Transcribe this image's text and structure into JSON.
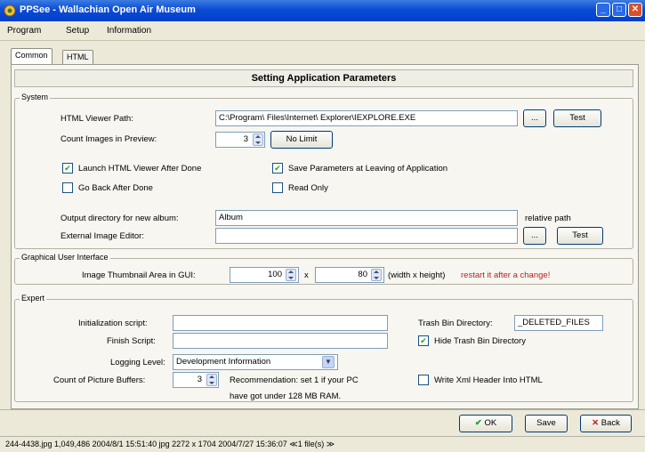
{
  "window": {
    "title": "PPSee - Wallachian Open Air Museum",
    "controls": [
      "_",
      "□",
      "✕"
    ]
  },
  "menu": [
    "Program",
    "Setup",
    "Information"
  ],
  "tabs": [
    "Common",
    "HTML"
  ],
  "header": "Setting Application Parameters",
  "system": {
    "legend": "System",
    "viewer_path_label": "HTML Viewer Path:",
    "viewer_path_value": "C:\\Program\\ Files\\Internet\\ Explorer\\IEXPLORE.EXE",
    "browse_label": "...",
    "test_label": "Test",
    "count_images_label": "Count Images in Preview:",
    "count_images_value": "3",
    "no_limit_label": "No Limit",
    "launch_viewer_label": "Launch HTML Viewer After Done",
    "save_params_label": "Save Parameters at Leaving of Application",
    "go_back_label": "Go Back After Done",
    "read_only_label": "Read Only",
    "output_dir_label": "Output directory for new album:",
    "output_dir_value": "Album",
    "relative_path_label": "relative path",
    "ext_editor_label": "External Image Editor:",
    "ext_editor_value": "",
    "browse2_label": "...",
    "test2_label": "Test"
  },
  "gui": {
    "legend": "Graphical User Interface",
    "thumb_label": "Image Thumbnail Area in GUI:",
    "width_value": "100",
    "times_label": "x",
    "height_value": "80",
    "wh_label": "(width x height)",
    "restart_note": "restart it after a change!"
  },
  "expert": {
    "legend": "Expert",
    "init_script_label": "Initialization script:",
    "init_script_value": "",
    "finish_script_label": "Finish Script:",
    "finish_script_value": "",
    "logging_label": "Logging Level:",
    "logging_value": "Development Information",
    "buffers_label": "Count of Picture Buffers:",
    "buffers_value": "3",
    "recommendation_line1": "Recommendation: set 1 if your PC",
    "recommendation_line2": "have got under 128 MB RAM.",
    "trash_dir_label": "Trash Bin Directory:",
    "trash_dir_value": "_DELETED_FILES",
    "hide_trash_label": "Hide Trash Bin Directory",
    "write_xml_label": "Write Xml Header Into HTML"
  },
  "buttons": {
    "ok": "OK",
    "save": "Save",
    "back": "Back"
  },
  "status": "244-4438.jpg   1,049,486  2004/8/1 15:51:40  jpg  2272 x 1704  2004/7/27 15:36:07  ≪1 file(s) ≫",
  "checkbox_states": {
    "launch_viewer": true,
    "save_params": true,
    "go_back": false,
    "read_only": false,
    "hide_trash": true,
    "write_xml": false
  },
  "colors": {
    "titlebar": "#0a4bd6",
    "warning": "#c01c1c",
    "check": "#21a121"
  }
}
